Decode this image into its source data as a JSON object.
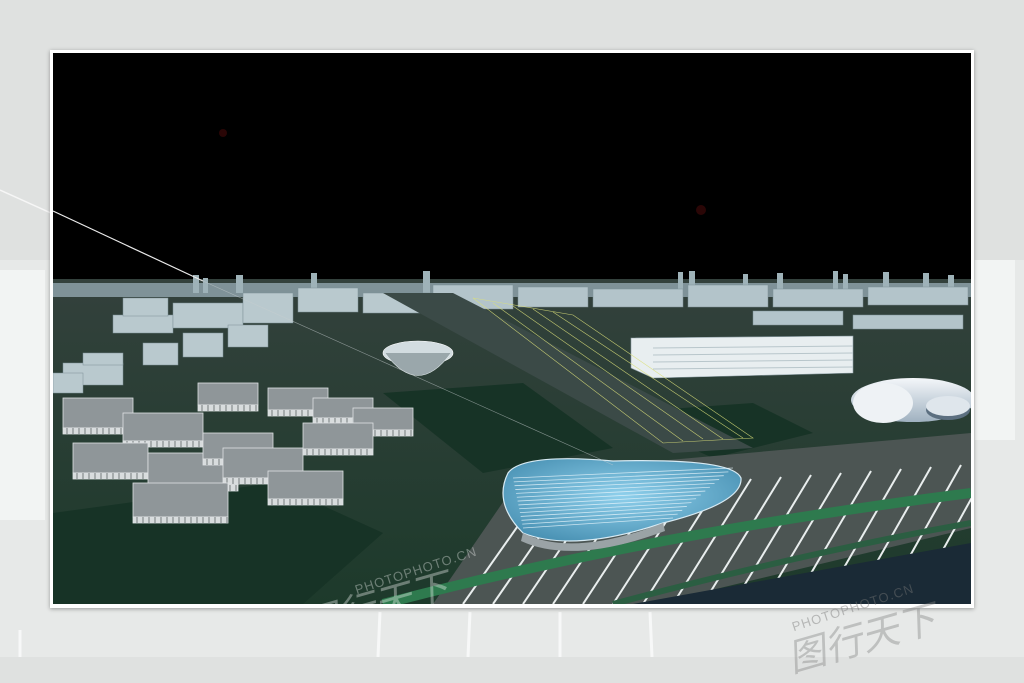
{
  "image": {
    "subject": "3D rendered aerial view of an urban district at night",
    "background_color": "#dfe1e0",
    "frame_color": "#ffffff",
    "sky_color": "#000000",
    "ground_color": "#1e3a2c",
    "building_color": "#b9c7cc",
    "highlight_color": "#dbe07a",
    "stadium_color": "#6fb3d4"
  },
  "watermark": {
    "logo_1": "图行天下",
    "text_1": "PHOTOPHOTO.CN",
    "logo_2": "图行天下",
    "text_2": "PHOTOPHOTO.CN"
  }
}
